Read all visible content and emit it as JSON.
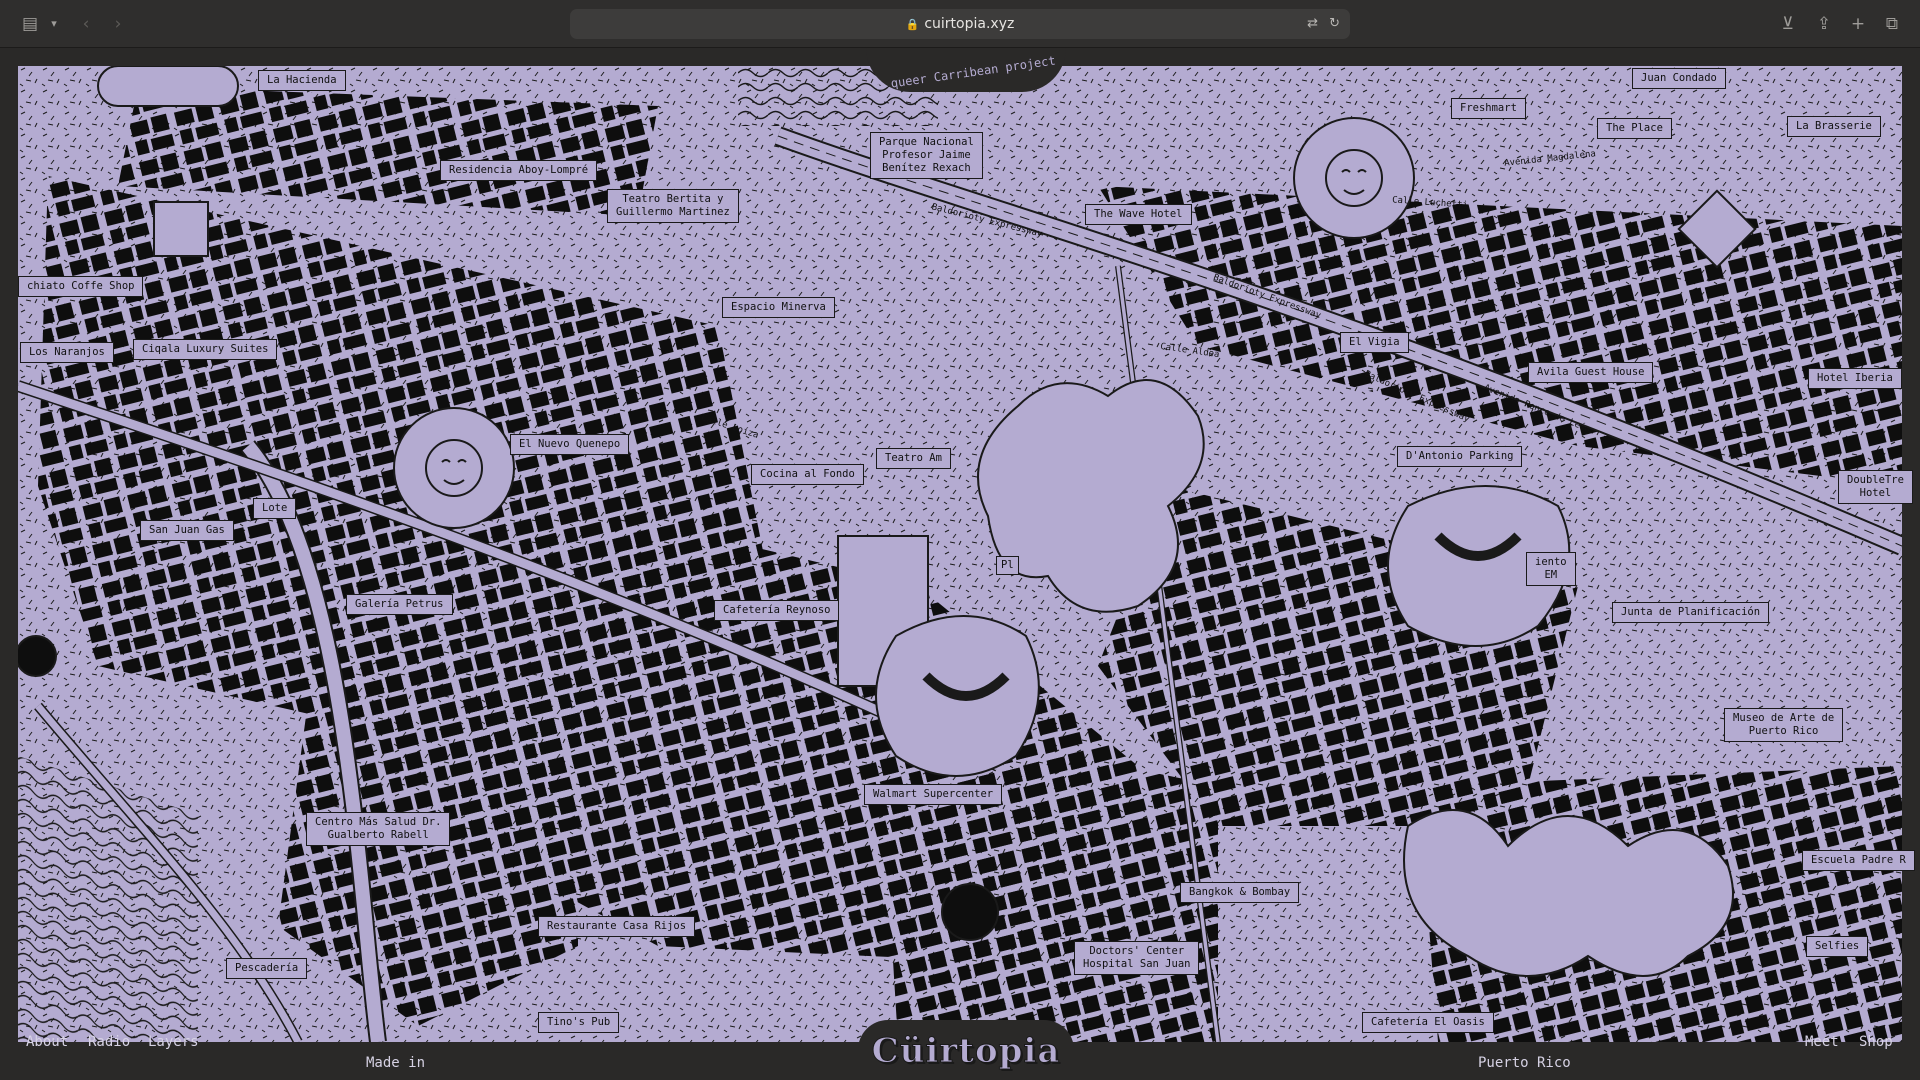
{
  "browser": {
    "url": "cuirtopia.xyz"
  },
  "site": {
    "tagline": "A queer Carribean project",
    "logo": "Cüirtopia",
    "made_in_left": "Made in",
    "made_in_right": "Puerto Rico"
  },
  "nav": {
    "left": [
      "About",
      "Radio",
      "Layers"
    ],
    "right": [
      "Meet",
      "Shop"
    ]
  },
  "colors": {
    "map_bg": "#b4abd1",
    "ink": "#1a1a1a",
    "chrome": "#2f2e2d"
  },
  "places": [
    "La Hacienda",
    "Residencia Aboy-Lompré",
    "Teatro Bertita y\nGuillermo Martinez",
    "Parque Nacional\nProfesor Jaime\nBenítez Rexach",
    "chiato Coffe Shop",
    "Los Naranjos",
    "Ciqala Luxury Suites",
    "Espacio Minerva",
    "The Wave Hotel",
    "Juan Condado",
    "Freshmart",
    "The Place",
    "La Brasserie",
    "El Vigia",
    "Avila Guest House",
    "Hotel Iberia",
    "El Nuevo Quenepo",
    "Cocina al Fondo",
    "Teatro Am",
    "D'Antonio Parking",
    "Lote",
    "San Juan Gas",
    "DoubleTre\nHotel",
    "Galería Petrus",
    "Cafetería Reynoso",
    "Junta de Planificación",
    "iento\nEM",
    "Museo de Arte de\nPuerto Rico",
    "Walmart Supercenter",
    "Centro Más Salud Dr.\nGualberto Rabell",
    "Bangkok & Bombay",
    "Escuela Padre R",
    "Restaurante Casa Rijos",
    "Doctors' Center\nHospital San Juan",
    "Selfies",
    "Pescadería",
    "Tino's Pub",
    "Cafetería El Oasis",
    "Pl"
  ],
  "streets": [
    "Baldorioty Expressway",
    "Avenida Ponce de León",
    "Calle Loíza",
    "Calle Aldea",
    "Calle Luchetti",
    "Avenida Magdalena"
  ]
}
